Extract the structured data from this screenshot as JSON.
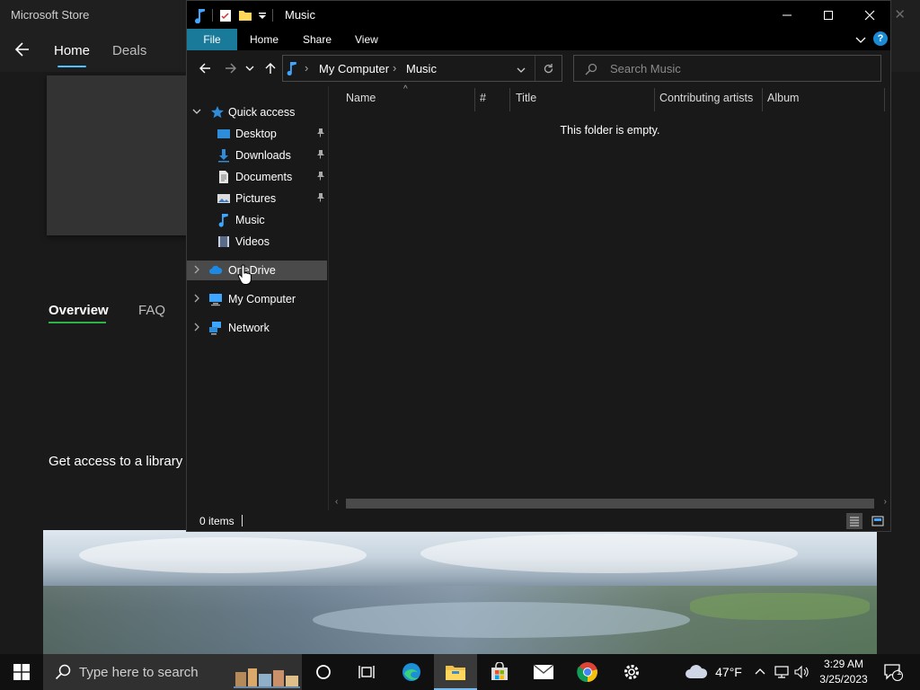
{
  "store": {
    "app_title": "Microsoft Store",
    "nav": {
      "home": "Home",
      "deals": "Deals"
    },
    "tabs": {
      "overview": "Overview",
      "faq": "FAQ"
    },
    "description": "Get access to a library c"
  },
  "explorer": {
    "title": "Music",
    "ribbon": {
      "file": "File",
      "home": "Home",
      "share": "Share",
      "view": "View",
      "help": "?"
    },
    "breadcrumb": [
      "My Computer",
      "Music"
    ],
    "search_placeholder": "Search Music",
    "nav_pane": {
      "quick_access": "Quick access",
      "items": [
        {
          "label": "Desktop",
          "icon": "desktop-icon",
          "pinned": true
        },
        {
          "label": "Downloads",
          "icon": "downloads-icon",
          "pinned": true
        },
        {
          "label": "Documents",
          "icon": "documents-icon",
          "pinned": true
        },
        {
          "label": "Pictures",
          "icon": "pictures-icon",
          "pinned": true
        },
        {
          "label": "Music",
          "icon": "music-icon",
          "pinned": false
        },
        {
          "label": "Videos",
          "icon": "videos-icon",
          "pinned": false
        }
      ],
      "onedrive": "OneDrive",
      "my_computer": "My Computer",
      "network": "Network"
    },
    "columns": [
      "Name",
      "#",
      "Title",
      "Contributing artists",
      "Album"
    ],
    "empty_message": "This folder is empty.",
    "status": "0 items"
  },
  "taskbar": {
    "search_placeholder": "Type here to search",
    "weather": "47°F",
    "time": "3:29 AM",
    "date": "3/25/2023",
    "notification_count": "1"
  },
  "colors": {
    "ribbon_file": "#1a7a9a",
    "accent": "#4cc2ff",
    "overview_underline": "#2db34a",
    "selection": "#4a4a4a"
  }
}
